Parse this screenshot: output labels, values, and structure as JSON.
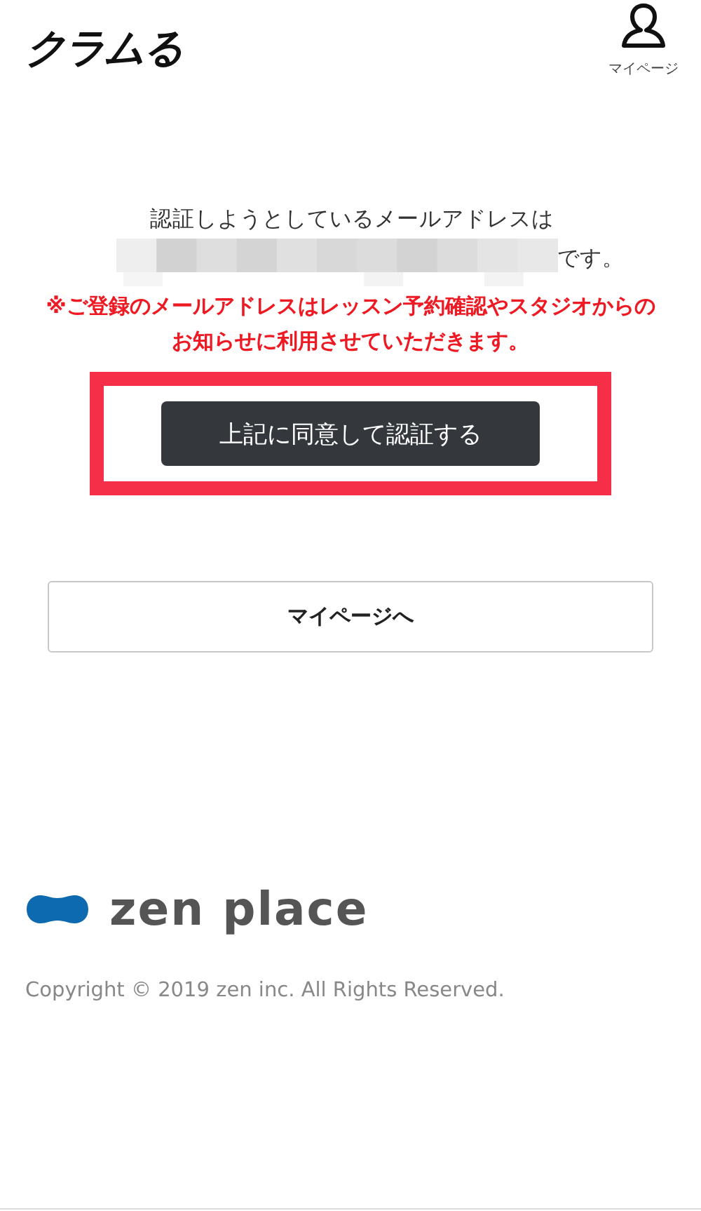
{
  "header": {
    "logo": "クラムる",
    "mypage_label": "マイページ"
  },
  "message": {
    "line_1": "認証しようとしているメールアドレスは",
    "line_2_suffix": "です。"
  },
  "notice": "※ご登録のメールアドレスはレッスン予約確認やスタジオからのお知らせに利用させていただきます。",
  "confirm_button": {
    "label": "上記に同意して認証する",
    "highlighted": true
  },
  "mypage_button": {
    "label": "マイページへ"
  },
  "footer": {
    "brand": "zen place",
    "copyright": "Copyright © 2019 zen inc. All Rights Reserved."
  }
}
